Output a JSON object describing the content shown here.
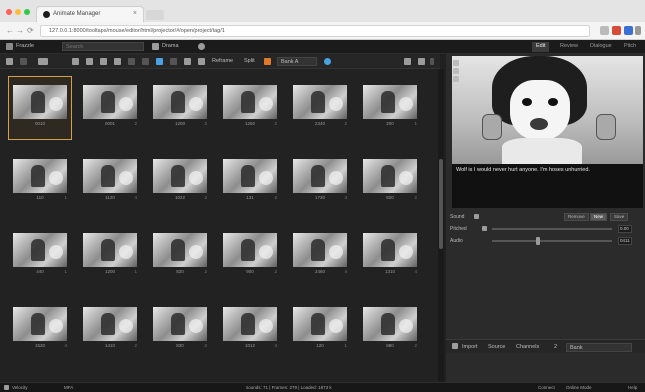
{
  "browser": {
    "tab_title": "Animate Manager",
    "tab_close": "×",
    "url": "127.0.0.1:8000/tooltaps/mouse/editor/html/projector/#/open/project/tag/1",
    "nav": {
      "back": "←",
      "forward": "→",
      "reload": "⟳"
    },
    "traffic_colors": [
      "#fc605b",
      "#fdbc40",
      "#34c84a"
    ]
  },
  "app": {
    "project_label": "Frazzle",
    "search_placeholder": "Search",
    "menu_label": "Drama",
    "modes": [
      {
        "label": "Edit",
        "active": true
      },
      {
        "label": "Review",
        "active": false
      },
      {
        "label": "Dialogue",
        "active": false
      },
      {
        "label": "Pitch",
        "active": false
      }
    ]
  },
  "toolbar": {
    "reframe_label": "Reframe",
    "split_label": "Split",
    "bank_label": "Bank A",
    "icons": [
      "back-icon",
      "pencil-icon",
      "layers-icon",
      "grid-icon",
      "list-icon",
      "trash-icon",
      "eye-icon",
      "bucket-icon",
      "frame-icon",
      "color-icon"
    ]
  },
  "grid": {
    "cells": [
      {
        "label": "0010",
        "stat": "",
        "selected": true
      },
      {
        "label": "0001",
        "stat": "2"
      },
      {
        "label": "1200",
        "stat": "2"
      },
      {
        "label": "1250",
        "stat": "2"
      },
      {
        "label": "2340",
        "stat": "2"
      },
      {
        "label": "200",
        "stat": "1"
      },
      {
        "label": "110",
        "stat": "1"
      },
      {
        "label": "1120",
        "stat": "4"
      },
      {
        "label": "1022",
        "stat": "2"
      },
      {
        "label": "131",
        "stat": "2"
      },
      {
        "label": "1730",
        "stat": "4"
      },
      {
        "label": "820",
        "stat": "2"
      },
      {
        "label": "440",
        "stat": "1"
      },
      {
        "label": "1200",
        "stat": "1"
      },
      {
        "label": "820",
        "stat": "2"
      },
      {
        "label": "900",
        "stat": "2"
      },
      {
        "label": "2460",
        "stat": "4"
      },
      {
        "label": "1310",
        "stat": "4"
      },
      {
        "label": "1530",
        "stat": "4"
      },
      {
        "label": "1410",
        "stat": "2"
      },
      {
        "label": "830",
        "stat": "2"
      },
      {
        "label": "1012",
        "stat": "4"
      },
      {
        "label": "120",
        "stat": "1"
      },
      {
        "label": "880",
        "stat": "2"
      }
    ]
  },
  "panel": {
    "caption": "Wolf is I would never hurt anyone. I'm hoses unhurried.",
    "sound_label": "Sound",
    "sound_toggle": [
      "Remove",
      "New",
      "Save"
    ],
    "pitch_label": "Pitched",
    "pitch_value": "0.00",
    "audio_label": "Audio",
    "audio_value": "0411",
    "footer": {
      "import_label": "Import",
      "source_label": "Source",
      "channels_label": "Channels",
      "channels_value": "2",
      "bank_label": "Bank"
    }
  },
  "status": {
    "left": "Velocity",
    "left2": "MFA",
    "center": "sounds: 71 | Frames: 279 | Loaded: 1873 k",
    "right1": "Connect",
    "right2": "Online Mode",
    "right3": "Help"
  },
  "colors": {
    "accent": "#d4a050",
    "highlight_blue": "#4aa3e0",
    "highlight_orange": "#e07a2a"
  }
}
